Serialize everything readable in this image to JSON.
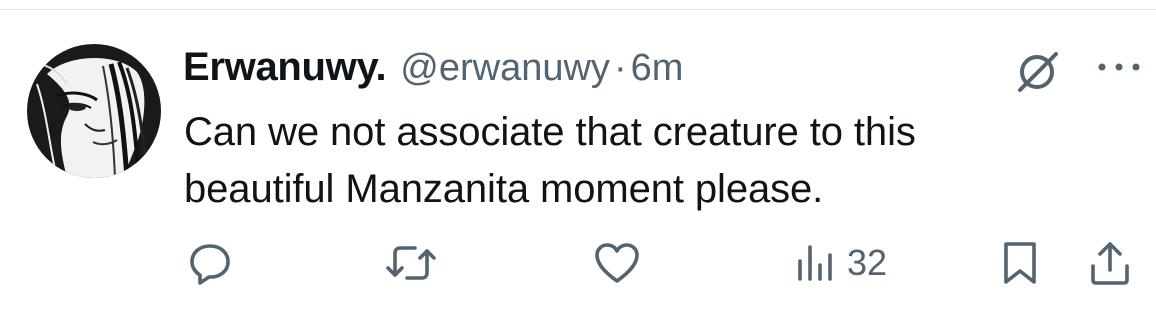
{
  "tweet": {
    "author_name": "Erwanuwy.",
    "handle": "@erwanuwy",
    "separator": "·",
    "time": "6m",
    "text_lines": [
      "Can we not associate that creature to this",
      "beautiful Manzanita moment please."
    ]
  },
  "actions": {
    "views_count": "32"
  },
  "icons": {
    "avatar": "avatar-image",
    "grok": "grok-icon",
    "more": "more-options-icon",
    "reply": "reply-icon",
    "retweet": "retweet-icon",
    "like": "heart-icon",
    "views": "views-icon",
    "bookmark": "bookmark-icon",
    "share": "share-icon"
  },
  "colors": {
    "text": "#0f1419",
    "secondary": "#536471",
    "divider": "#e6e9ec"
  }
}
